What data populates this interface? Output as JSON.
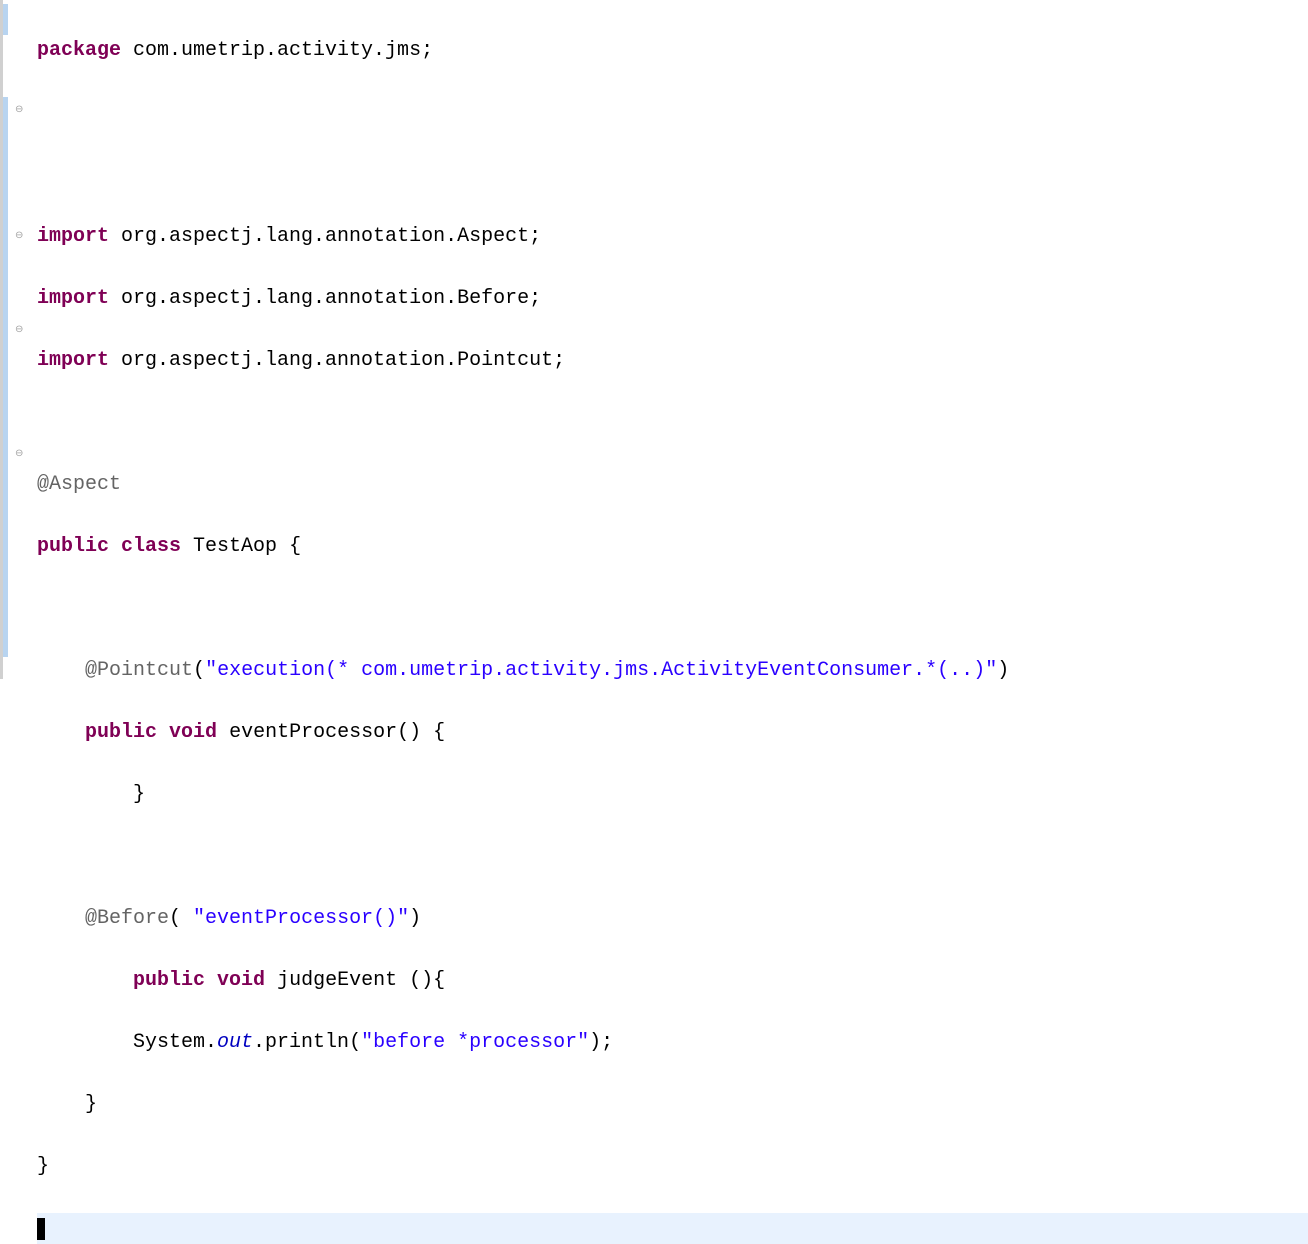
{
  "code": {
    "line1_kw": "package",
    "line1_rest": " com.umetrip.activity.jms;",
    "line3_kw": "import",
    "line3_rest": " org.aspectj.lang.annotation.Aspect;",
    "line4_kw": "import",
    "line4_rest": " org.aspectj.lang.annotation.Before;",
    "line5_kw": "import",
    "line5_rest": " org.aspectj.lang.annotation.Pointcut;",
    "line7_ann": "@Aspect",
    "line8_kw1": "public",
    "line8_kw2": "class",
    "line8_rest": " TestAop {",
    "line10_ann": "@Pointcut",
    "line10_str": "\"execution(* com.umetrip.activity.jms.ActivityEventConsumer.*(..)\"",
    "line11_kw1": "public",
    "line11_kw2": "void",
    "line11_rest": " eventProcessor() {",
    "line12": "        }",
    "line14_ann": "@Before",
    "line14_str": "\"eventProcessor()\"",
    "line15_kw1": "public",
    "line15_kw2": "void",
    "line15_rest": " judgeEvent (){",
    "line16_a": "        System.",
    "line16_out": "out",
    "line16_b": ".println(",
    "line16_str": "\"before *processor\"",
    "line16_c": ");",
    "line17": "    }",
    "line18": "}"
  }
}
